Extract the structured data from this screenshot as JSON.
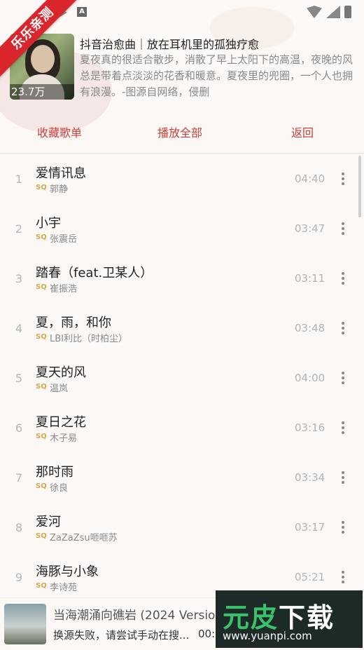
{
  "ribbon": {
    "text": "乐乐亲测"
  },
  "playlist": {
    "cover_count": "23.7万",
    "title": "抖音治愈曲｜放在耳机里的孤独疗愈",
    "description": "夏夜真的很适合散步，消散了早上太阳下的高温，夜晚的风总是带着点淡淡的花香和暖意。夏夜里的兜圈，一个人也拥有浪漫。-图源自网络，侵删"
  },
  "actions": {
    "collect": "收藏歌单",
    "play_all": "播放全部",
    "back": "返回"
  },
  "quality_tag": "SQ",
  "songs": [
    {
      "index": "1",
      "name": "爱情讯息",
      "artist": "郭静",
      "duration": "04:40"
    },
    {
      "index": "2",
      "name": "小宇",
      "artist": "张震岳",
      "duration": "03:47"
    },
    {
      "index": "3",
      "name": "踏春（feat.卫某人）",
      "artist": "崔振浩",
      "duration": "03:11"
    },
    {
      "index": "4",
      "name": "夏，雨，和你",
      "artist": "LBI利比（时柏尘）",
      "duration": "03:48"
    },
    {
      "index": "5",
      "name": "夏天的风",
      "artist": "温岚",
      "duration": "04:00"
    },
    {
      "index": "6",
      "name": "夏日之花",
      "artist": "木子易",
      "duration": "03:16"
    },
    {
      "index": "7",
      "name": "那时雨",
      "artist": "徐良",
      "duration": "03:34"
    },
    {
      "index": "8",
      "name": "爱河",
      "artist": "ZaZaZsu咂咂苏",
      "duration": "03:17"
    },
    {
      "index": "9",
      "name": "海豚与小象",
      "artist": "李诗苑",
      "duration": "05:21"
    }
  ],
  "player": {
    "title": "当海潮涌向礁岩 (2024 Version)",
    "status": "换源失败，请尝试手动在搜...",
    "time": "00:00"
  },
  "watermark": {
    "brand_a": "元",
    "brand_b": "皮",
    "brand_c": "下载",
    "url": "www.yuanpi.com"
  },
  "colors": {
    "accent": "#c9403a",
    "ribbon": "#d8262c",
    "sq": "#d6a84a"
  }
}
